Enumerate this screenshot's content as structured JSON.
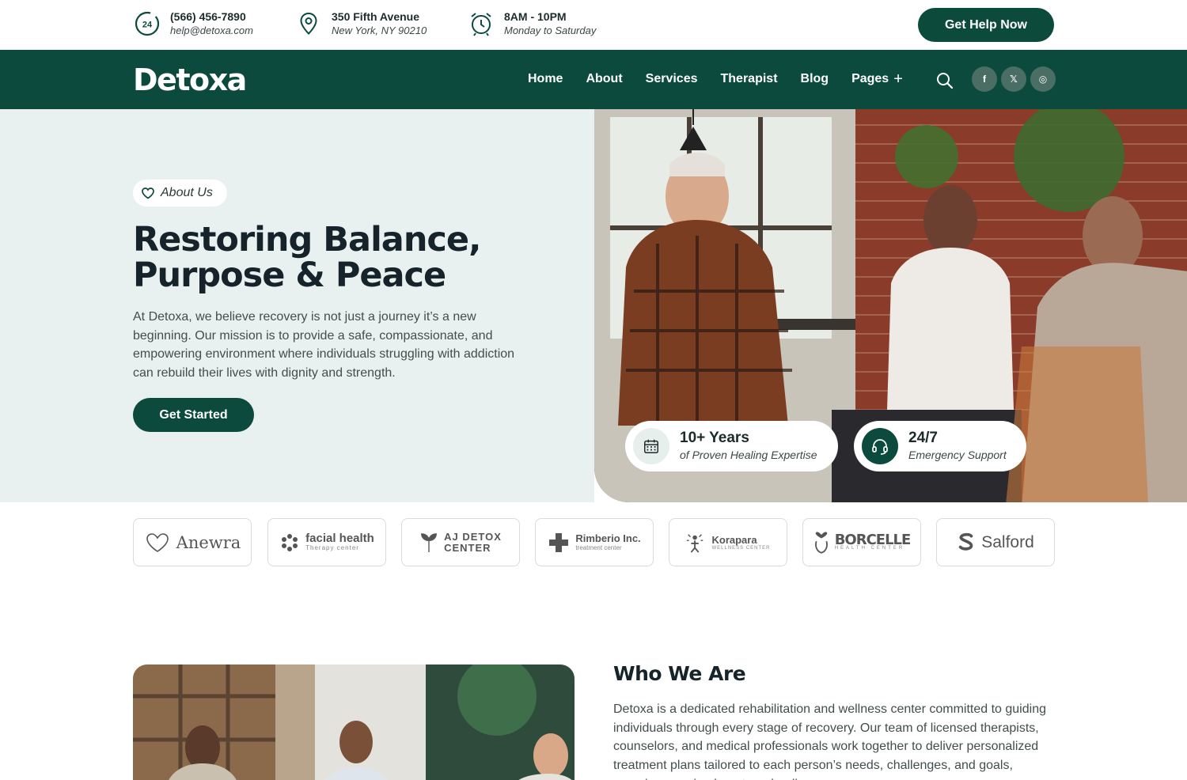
{
  "topbar": {
    "phone": "(566) 456-7890",
    "email": "help@detoxa.com",
    "address_line1": "350 Fifth Avenue",
    "address_line2": "New York, NY 90210",
    "hours": "8AM - 10PM",
    "days": "Monday to Saturday",
    "help_button": "Get Help Now",
    "icons": [
      "24h-clock-icon",
      "location-pin-icon",
      "alarm-clock-icon"
    ]
  },
  "nav": {
    "logo": "Detoxa",
    "items": [
      "Home",
      "About",
      "Services",
      "Therapist",
      "Blog",
      "Pages"
    ],
    "pages_toggle": "+",
    "socials": [
      "f",
      "𝕏",
      "◎"
    ],
    "accent_color": "#0b4a3c"
  },
  "hero": {
    "badge": "About Us",
    "title": "Restoring Balance, Purpose & Peace",
    "text": "At Detoxa, we believe recovery is not just a journey it’s a new beginning. Our mission is to provide a safe, compassionate, and empowering environment where individuals struggling with addiction can rebuild their lives with dignity and strength.",
    "button": "Get Started",
    "stats": [
      {
        "value": "10+ Years",
        "label": "of Proven Healing Expertise",
        "icon": "calendar-icon"
      },
      {
        "value": "24/7",
        "label": "Emergency Support",
        "icon": "headset-icon"
      }
    ]
  },
  "brands": [
    {
      "name": "Anewra",
      "sub": ""
    },
    {
      "name": "facial health",
      "sub": "Therapy center"
    },
    {
      "name": "AJ DETOX",
      "sub": "CENTER"
    },
    {
      "name": "Rimberio Inc.",
      "sub": "treatment center"
    },
    {
      "name": "Korapara",
      "sub": "WELLNESS CENTER"
    },
    {
      "name": "BORCELLE",
      "sub": "HEALTH CENTER"
    },
    {
      "name": "Salford",
      "sub": ""
    }
  ],
  "who": {
    "title": "Who We Are",
    "text": "Detoxa is a dedicated rehabilitation and wellness center committed to guiding individuals through every stage of recovery. Our team of licensed therapists, counselors, and medical professionals work together to deliver personalized treatment plans tailored to each person’s needs, challenges, and goals, ensuring genuine long-term healing."
  }
}
